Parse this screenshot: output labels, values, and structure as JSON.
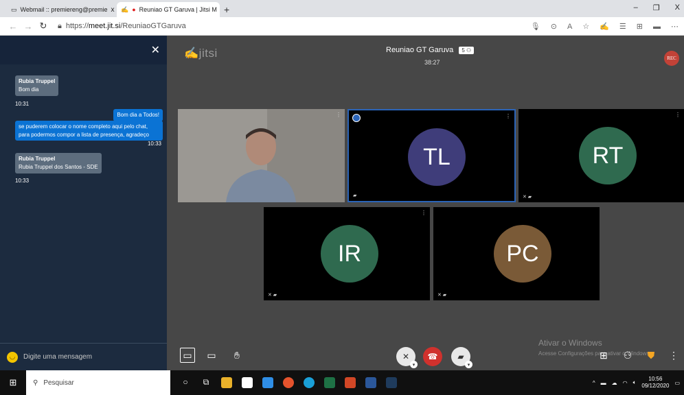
{
  "browser": {
    "tabs": [
      {
        "label": "Webmail :: premiereng@premie",
        "close": "x"
      },
      {
        "label": "Reuniao GT Garuva | Jitsi M",
        "close": "x"
      }
    ],
    "newtab": "+",
    "window": {
      "minimize": "–",
      "maximize": "❐",
      "close": "X"
    },
    "url_prefix": "https://",
    "url_domain": "meet.jit.si",
    "url_path": "/ReuniaoGTGaruva"
  },
  "chat": {
    "close": "✕",
    "messages": [
      {
        "name": "Rubia Truppel",
        "text": "Bom dia",
        "time": "10:31"
      },
      {
        "text": "Bom dia a Todos!"
      },
      {
        "text_line1": "se puderem colocar o nome completo aqui pelo chat,",
        "text_line2": "para podermos compor a lista de presença, agradeço",
        "time": "10:33"
      },
      {
        "name": "Rubia Truppel",
        "text": "Rubia Truppel dos Santos - SDE",
        "time": "10:33"
      }
    ],
    "input_placeholder": "Digite uma mensagem"
  },
  "meeting": {
    "logo": "jitsi",
    "name": "Reuniao GT Garuva",
    "participant_count": "5",
    "timer": "38:27",
    "rec_label": "REC"
  },
  "tiles": [
    {
      "initials": "",
      "color": "#7c7a76"
    },
    {
      "initials": "TL",
      "color": "#3f3d7a"
    },
    {
      "initials": "RT",
      "color": "#2f6a4f"
    },
    {
      "initials": "IR",
      "color": "#2f6a4f"
    },
    {
      "initials": "PC",
      "color": "#7a5a37"
    }
  ],
  "watermark": {
    "line1": "Ativar o Windows",
    "line2": "Acesse Configurações para ativar o Windows."
  },
  "taskbar": {
    "search_placeholder": "Pesquisar",
    "time": "10:56",
    "date": "09/12/2020"
  }
}
